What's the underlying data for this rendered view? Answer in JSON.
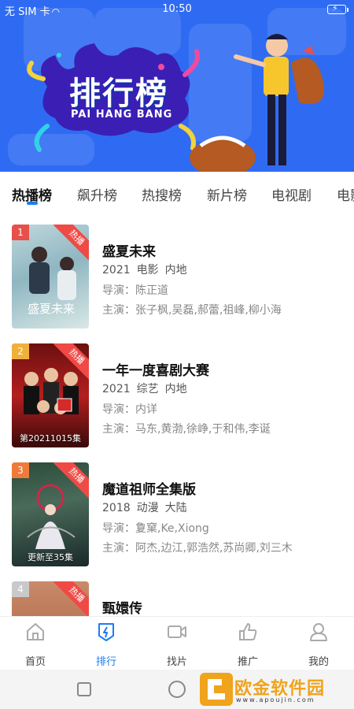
{
  "status_bar": {
    "carrier": "无 SIM 卡",
    "time": "10:50"
  },
  "banner": {
    "title": "排行榜",
    "subtitle": "PAI HANG BANG"
  },
  "tabs": [
    "热播榜",
    "飙升榜",
    "热搜榜",
    "新片榜",
    "电视剧",
    "电影"
  ],
  "labels": {
    "director_prefix": "导演：",
    "cast_prefix": "主演：",
    "hot_badge": "热播"
  },
  "items": [
    {
      "rank": "1",
      "title": "盛夏未来",
      "year": "2021",
      "type": "电影",
      "region": "内地",
      "director": "陈正道",
      "cast": "张子枫,吴磊,郝蕾,祖峰,柳小海",
      "poster_caption": "",
      "rank_color": "#e8504a"
    },
    {
      "rank": "2",
      "title": "一年一度喜剧大赛",
      "year": "2021",
      "type": "综艺",
      "region": "内地",
      "director": "内详",
      "cast": "马东,黄渤,徐峥,于和伟,李诞",
      "poster_caption": "第20211015集",
      "rank_color": "#f0b03a"
    },
    {
      "rank": "3",
      "title": "魔道祖师全集版",
      "year": "2018",
      "type": "动漫",
      "region": "大陆",
      "director": "夐窠,Ke,Xiong",
      "cast": "阿杰,边江,郭浩然,苏尚卿,刘三木",
      "poster_caption": "更新至35集",
      "rank_color": "#f07a3a"
    },
    {
      "rank": "4",
      "title": "甄嬛传",
      "year": "",
      "type": "",
      "region": "",
      "director": "",
      "cast": "",
      "poster_caption": "",
      "rank_color": "#c9c9c9"
    }
  ],
  "bottom_nav": [
    {
      "label": "首页",
      "icon": "home-icon"
    },
    {
      "label": "排行",
      "icon": "rank-icon"
    },
    {
      "label": "找片",
      "icon": "video-camera-icon"
    },
    {
      "label": "推广",
      "icon": "thumbs-up-icon"
    },
    {
      "label": "我的",
      "icon": "user-icon"
    }
  ],
  "watermark": {
    "text": "欧金软件园",
    "url": "www.apoujin.com"
  },
  "colors": {
    "accent": "#1d7cf2",
    "banner_bg": "#2f6bf2",
    "hot_badge": "#ef4a45",
    "watermark": "#f0a31c"
  }
}
